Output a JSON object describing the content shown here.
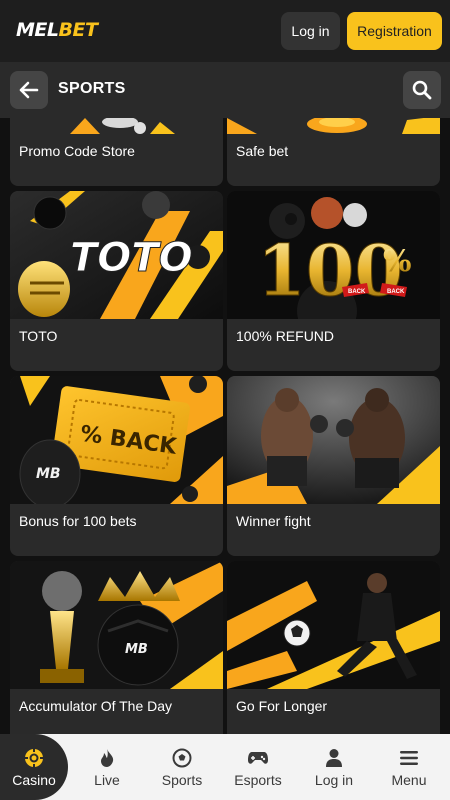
{
  "header": {
    "logo_part1": "MEL",
    "logo_part2": "BET",
    "login_label": "Log in",
    "registration_label": "Registration"
  },
  "subheader": {
    "title": "SPORTS"
  },
  "cards": [
    {
      "label": "Promo Code Store"
    },
    {
      "label": "Safe bet"
    },
    {
      "label": "TOTO",
      "banner_text": "TOTO"
    },
    {
      "label": "100% REFUND",
      "banner_text": "100",
      "banner_symbol": "%",
      "ribbon_left": "BACK",
      "ribbon_right": "BACK"
    },
    {
      "label": "Bonus for 100 bets",
      "banner_text": "% BACK",
      "badge": "MB"
    },
    {
      "label": "Winner fight"
    },
    {
      "label": "Accumulator Of The Day",
      "badge": "MB"
    },
    {
      "label": "Go For Longer"
    }
  ],
  "bottom_nav": [
    {
      "label": "Casino",
      "icon": "casino-chip-icon",
      "active": true
    },
    {
      "label": "Live",
      "icon": "flame-icon"
    },
    {
      "label": "Sports",
      "icon": "soccer-ball-icon"
    },
    {
      "label": "Esports",
      "icon": "gamepad-icon"
    },
    {
      "label": "Log in",
      "icon": "user-icon"
    },
    {
      "label": "Menu",
      "icon": "hamburger-icon"
    }
  ],
  "colors": {
    "accent": "#f9c21c",
    "background": "#111111",
    "card": "#2a2a2a",
    "nav_bg": "#f3f3f3"
  }
}
